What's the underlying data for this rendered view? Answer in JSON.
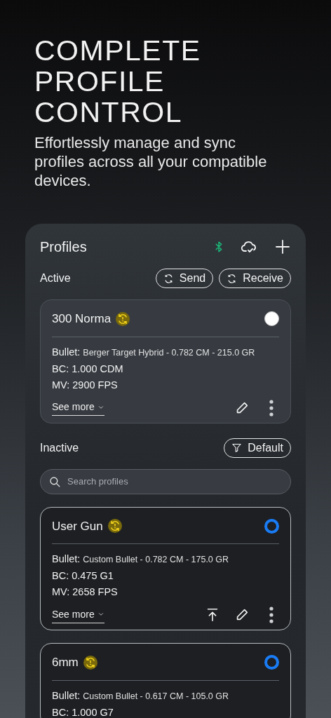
{
  "hero": {
    "title": "COMPLETE PROFILE CONTROL",
    "subtitle": "Effortlessly manage and sync profiles across all your compatible devices."
  },
  "panel": {
    "title": "Profiles",
    "bluetooth_connected": true,
    "active_section": {
      "label": "Active",
      "buttons": [
        {
          "label": "Send"
        },
        {
          "label": "Receive"
        }
      ],
      "profiles": [
        {
          "name": "300 Norma",
          "selected": false,
          "sync_warning": true,
          "actions": [
            {
              "kind": "edit"
            },
            {
              "kind": "more"
            }
          ],
          "details": [
            {
              "label": "Bullet:",
              "value": "Berger Target Hybrid - 0.782 CM - 215.0 GR",
              "kind": "small"
            },
            {
              "label": "BC:",
              "value": "1.000 CDM",
              "kind": "plain"
            },
            {
              "label": "MV:",
              "value": "2900 FPS",
              "kind": "plain"
            }
          ],
          "see_more": "See more"
        }
      ]
    },
    "inactive_section": {
      "label": "Inactive",
      "filter": "Default",
      "search": {
        "placeholder": "Search profiles"
      },
      "profiles": [
        {
          "name": "User Gun",
          "selected": true,
          "sync_warning": true,
          "actions": [
            {
              "kind": "upload"
            },
            {
              "kind": "edit"
            },
            {
              "kind": "more"
            }
          ],
          "details": [
            {
              "label": "Bullet:",
              "value": "Custom Bullet - 0.782 CM - 175.0 GR",
              "kind": "small"
            },
            {
              "label": "BC:",
              "value": "0.475 G1",
              "kind": "plain"
            },
            {
              "label": "MV:",
              "value": "2658 FPS",
              "kind": "plain"
            }
          ],
          "see_more": "See more"
        },
        {
          "name": "6mm",
          "selected": true,
          "sync_warning": true,
          "details": [
            {
              "label": "Bullet:",
              "value": "Custom Bullet - 0.617 CM - 105.0 GR",
              "kind": "small"
            },
            {
              "label": "BC:",
              "value": "1.000 G7",
              "kind": "plain"
            }
          ]
        }
      ]
    }
  }
}
